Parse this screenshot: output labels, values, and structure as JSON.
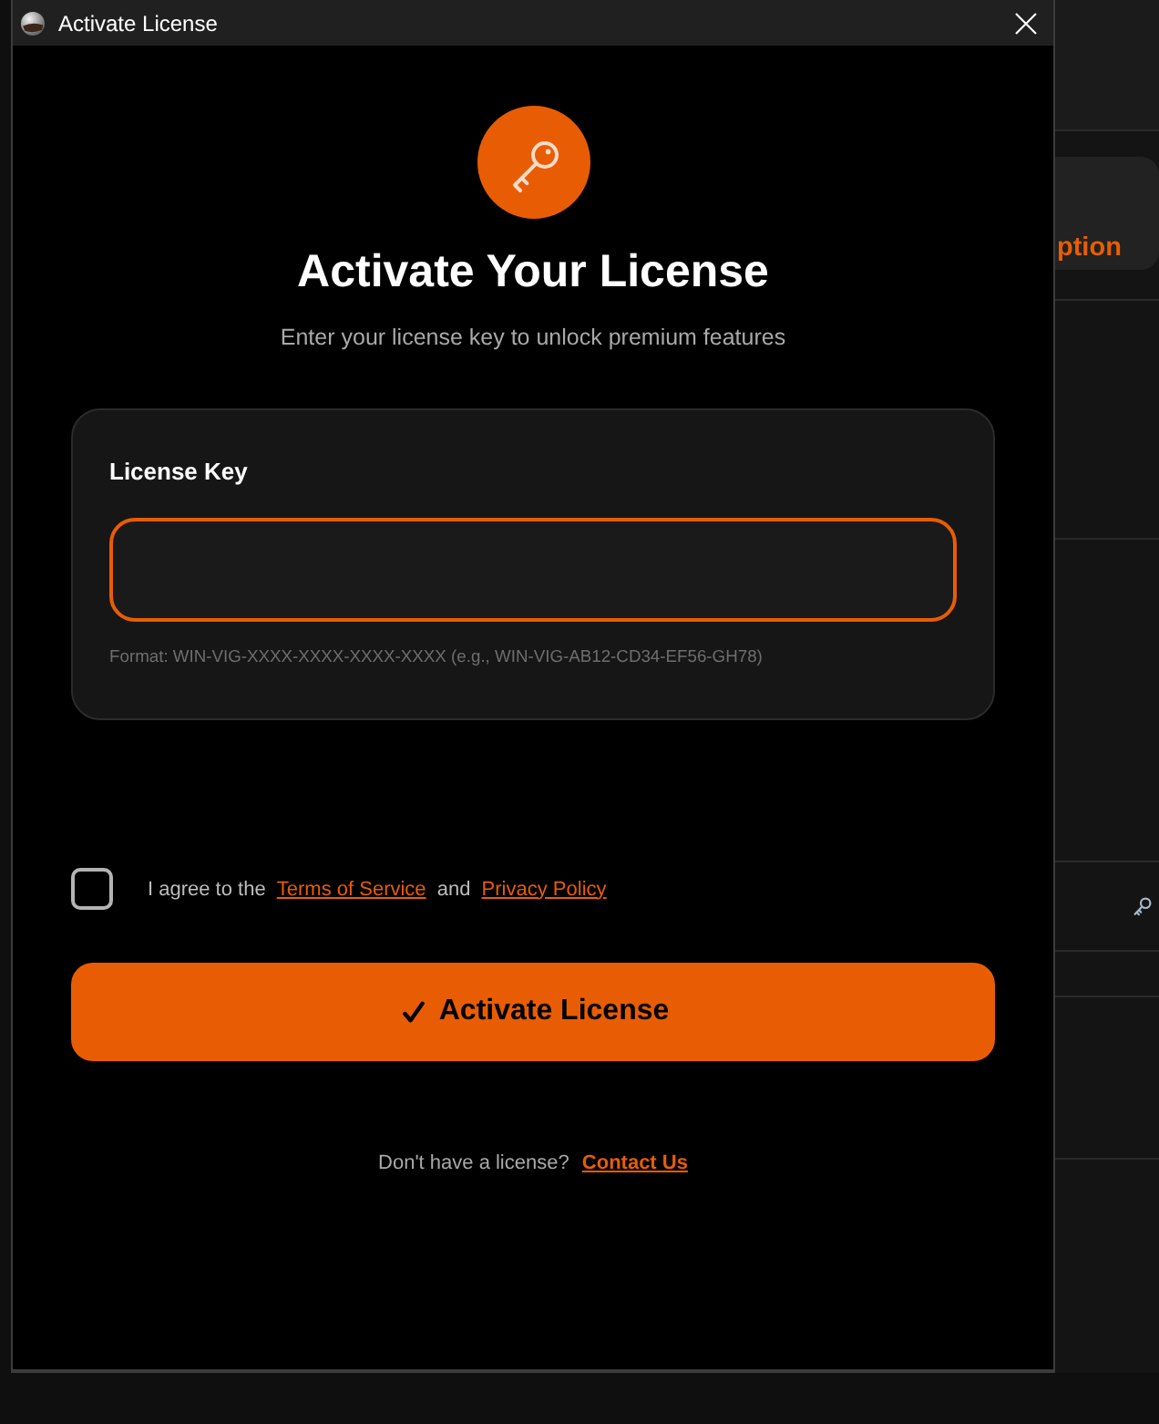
{
  "window": {
    "title": "Activate License"
  },
  "header": {
    "heading": "Activate Your License",
    "subtitle": "Enter your license key to unlock premium features"
  },
  "license_field": {
    "label": "License Key",
    "focused": true,
    "hint": "Format: WIN-VIG-XXXX-XXXX-XXXX-XXXX (e.g., WIN-VIG-AB12-CD34-EF56-GH78)"
  },
  "agreement": {
    "checked": false,
    "parts": [
      {
        "kind": "text",
        "text": "I agree to the"
      },
      {
        "kind": "link",
        "text": "Terms of Service"
      },
      {
        "kind": "text",
        "text": "and"
      },
      {
        "kind": "link",
        "text": "Privacy Policy"
      }
    ]
  },
  "activate_button": {
    "label": "Activate License"
  },
  "footer": {
    "text": "Don't have a license?",
    "link": "Contact Us"
  },
  "background_window": {
    "button_label": "ption"
  }
}
